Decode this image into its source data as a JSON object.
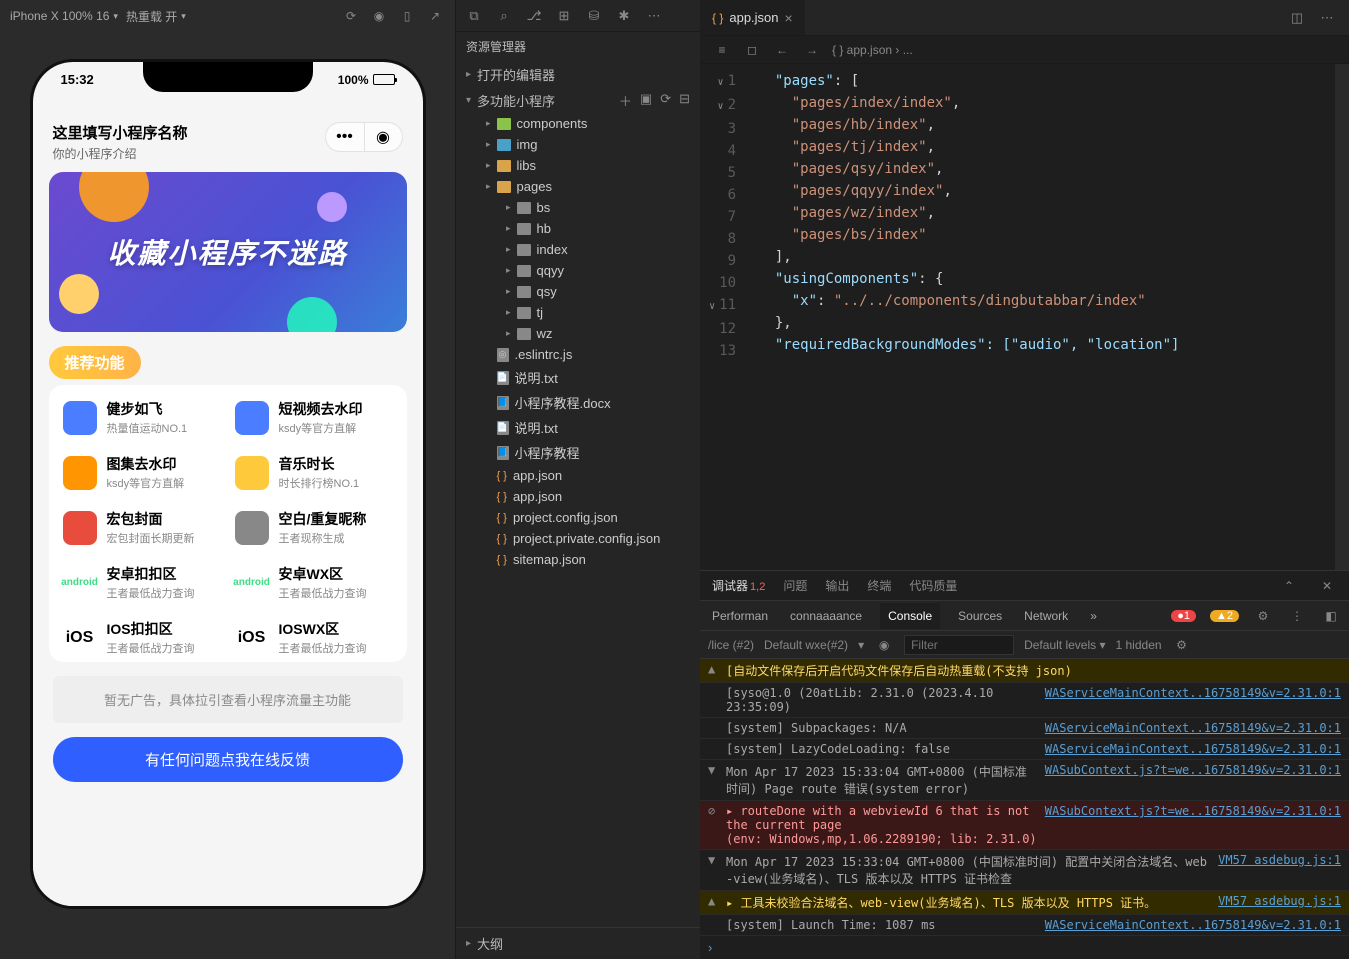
{
  "toolbar": {
    "device": "iPhone X 100% 16",
    "hot_reload": "热重载 开"
  },
  "phone": {
    "time": "15:32",
    "battery": "100%",
    "app_title": "这里填写小程序名称",
    "app_sub": "你的小程序介绍",
    "hero_text": "收藏小程序不迷路",
    "section_label": "推荐功能",
    "features": [
      {
        "title": "健步如飞",
        "sub": "热量值运动NO.1",
        "color": "#4a7dff"
      },
      {
        "title": "短视频去水印",
        "sub": "ksdy等官方直解",
        "color": "#4a7dff"
      },
      {
        "title": "图集去水印",
        "sub": "ksdy等官方直解",
        "color": "#ff9500"
      },
      {
        "title": "音乐时长",
        "sub": "时长排行榜NO.1",
        "color": "#ffc93c"
      },
      {
        "title": "宏包封面",
        "sub": "宏包封面长期更新",
        "color": "#e74c3c"
      },
      {
        "title": "空白/重复昵称",
        "sub": "王者现称生成",
        "color": "#888"
      },
      {
        "title": "安卓扣扣区",
        "sub": "王者最低战力查询",
        "color": "#3ddc84",
        "label": "android"
      },
      {
        "title": "安卓WX区",
        "sub": "王者最低战力查询",
        "color": "#3ddc84",
        "label": "android"
      },
      {
        "title": "IOS扣扣区",
        "sub": "王者最低战力查询",
        "color": "#000",
        "label": "iOS"
      },
      {
        "title": "IOSWX区",
        "sub": "王者最低战力查询",
        "color": "#000",
        "label": "iOS"
      }
    ],
    "ad_text": "暂无广告，具体拉引查看小程序流量主功能",
    "action_text": "有任何问题点我在线反馈"
  },
  "explorer": {
    "title": "资源管理器",
    "open_editors": "打开的编辑器",
    "project": "多功能小程序",
    "folders1": [
      {
        "name": "components",
        "v": "v3"
      },
      {
        "name": "img",
        "v": "v2"
      },
      {
        "name": "libs",
        "v": ""
      }
    ],
    "pages": "pages",
    "page_children": [
      "bs",
      "hb",
      "index",
      "qqyy",
      "qsy",
      "tj",
      "wz"
    ],
    "files": [
      {
        "name": ".eslintrc.js",
        "icon": "◎"
      },
      {
        "name": "说明.txt",
        "icon": "📄"
      },
      {
        "name": "小程序教程.docx",
        "icon": "📘"
      },
      {
        "name": "说明.txt",
        "icon": "📄"
      },
      {
        "name": "小程序教程",
        "icon": "📘"
      },
      {
        "name": "app.json",
        "json": true
      },
      {
        "name": "app.json",
        "json": true
      },
      {
        "name": "project.config.json",
        "json": true
      },
      {
        "name": "project.private.config.json",
        "json": true
      },
      {
        "name": "sitemap.json",
        "json": true
      }
    ],
    "outline": "大纲"
  },
  "editor": {
    "tab_name": "app.json",
    "breadcrumb": "{ } app.json ›  ...",
    "lines": [
      {
        "n": 1,
        "fold": "∨",
        "t": ""
      },
      {
        "n": 2,
        "fold": "∨",
        "key": "\"pages\"",
        "rest": ": ["
      },
      {
        "n": 3,
        "str": "\"pages/index/index\"",
        "comma": ","
      },
      {
        "n": 4,
        "str": "\"pages/hb/index\"",
        "comma": ","
      },
      {
        "n": 5,
        "str": "\"pages/tj/index\"",
        "comma": ","
      },
      {
        "n": 6,
        "str": "\"pages/qsy/index\"",
        "comma": ","
      },
      {
        "n": 7,
        "str": "\"pages/qqyy/index\"",
        "comma": ","
      },
      {
        "n": 8,
        "str": "\"pages/wz/index\"",
        "comma": ","
      },
      {
        "n": 9,
        "str": "\"pages/bs/index\""
      },
      {
        "n": 10,
        "close": "],"
      },
      {
        "n": 11,
        "fold": "∨",
        "key": "\"usingComponents\"",
        "rest": ": {"
      },
      {
        "n": 12,
        "key2": "\"x\"",
        "str": "\"../../components/dingbutabbar/index\""
      },
      {
        "n": 13,
        "close": "},"
      },
      {
        "n": "",
        "raw": "\"requiredBackgroundModes\": [\"audio\", \"location\"]"
      }
    ]
  },
  "console": {
    "outer_tabs": [
      "调试器",
      "问题",
      "输出",
      "终端",
      "代码质量"
    ],
    "outer_badge": "1,2",
    "dt_tabs": [
      "Performan",
      "connaaaance",
      "Console",
      "Sources",
      "Network"
    ],
    "err_count": "1",
    "warn_count": "2",
    "filter_left": "/lice (#2)",
    "filter_levels": "Default levels",
    "filter_placeholder": "Filter",
    "hidden": "1 hidden",
    "default_label": "Default  wxe(#2)",
    "logs": [
      {
        "type": "warn",
        "caret": "▲",
        "msg": "[自动文件保存后开启代码文件保存后自动热重载(不支持 json)",
        "src": ""
      },
      {
        "type": "info",
        "caret": "",
        "msg": "[syso@1.0 (20atLib: 2.31.0 (2023.4.10\n23:35:09)",
        "src": "WAServiceMainContext..16758149&v=2.31.0:1"
      },
      {
        "type": "info",
        "caret": "",
        "msg": "[system] Subpackages: N/A",
        "src": "WAServiceMainContext..16758149&v=2.31.0:1"
      },
      {
        "type": "info",
        "caret": "",
        "msg": "[system] LazyCodeLoading: false",
        "src": "WAServiceMainContext..16758149&v=2.31.0:1"
      },
      {
        "type": "info",
        "caret": "▼",
        "msg": "Mon Apr 17 2023 15:33:04 GMT+0800 (中国标准时间) Page route 错误(system error)",
        "src": "WASubContext.js?t=we..16758149&v=2.31.0:1"
      },
      {
        "type": "err",
        "caret": "⊘",
        "msg": "▸ routeDone with a webviewId 6 that is not the current page\n(env: Windows,mp,1.06.2289190; lib: 2.31.0)",
        "src": "WASubContext.js?t=we..16758149&v=2.31.0:1"
      },
      {
        "type": "info",
        "caret": "▼",
        "msg": "Mon Apr 17 2023 15:33:04 GMT+0800 (中国标准时间) 配置中关闭合法域名、web-view(业务域名)、TLS 版本以及 HTTPS 证书检查",
        "src": "VM57 asdebug.js:1"
      },
      {
        "type": "warn",
        "caret": "▲",
        "msg": "▸ 工具未校验合法域名、web-view(业务域名)、TLS 版本以及 HTTPS 证书。",
        "src": "VM57 asdebug.js:1"
      },
      {
        "type": "info",
        "caret": "",
        "msg": "[system] Launch Time: 1087 ms",
        "src": "WAServiceMainContext..16758149&v=2.31.0:1"
      }
    ]
  }
}
